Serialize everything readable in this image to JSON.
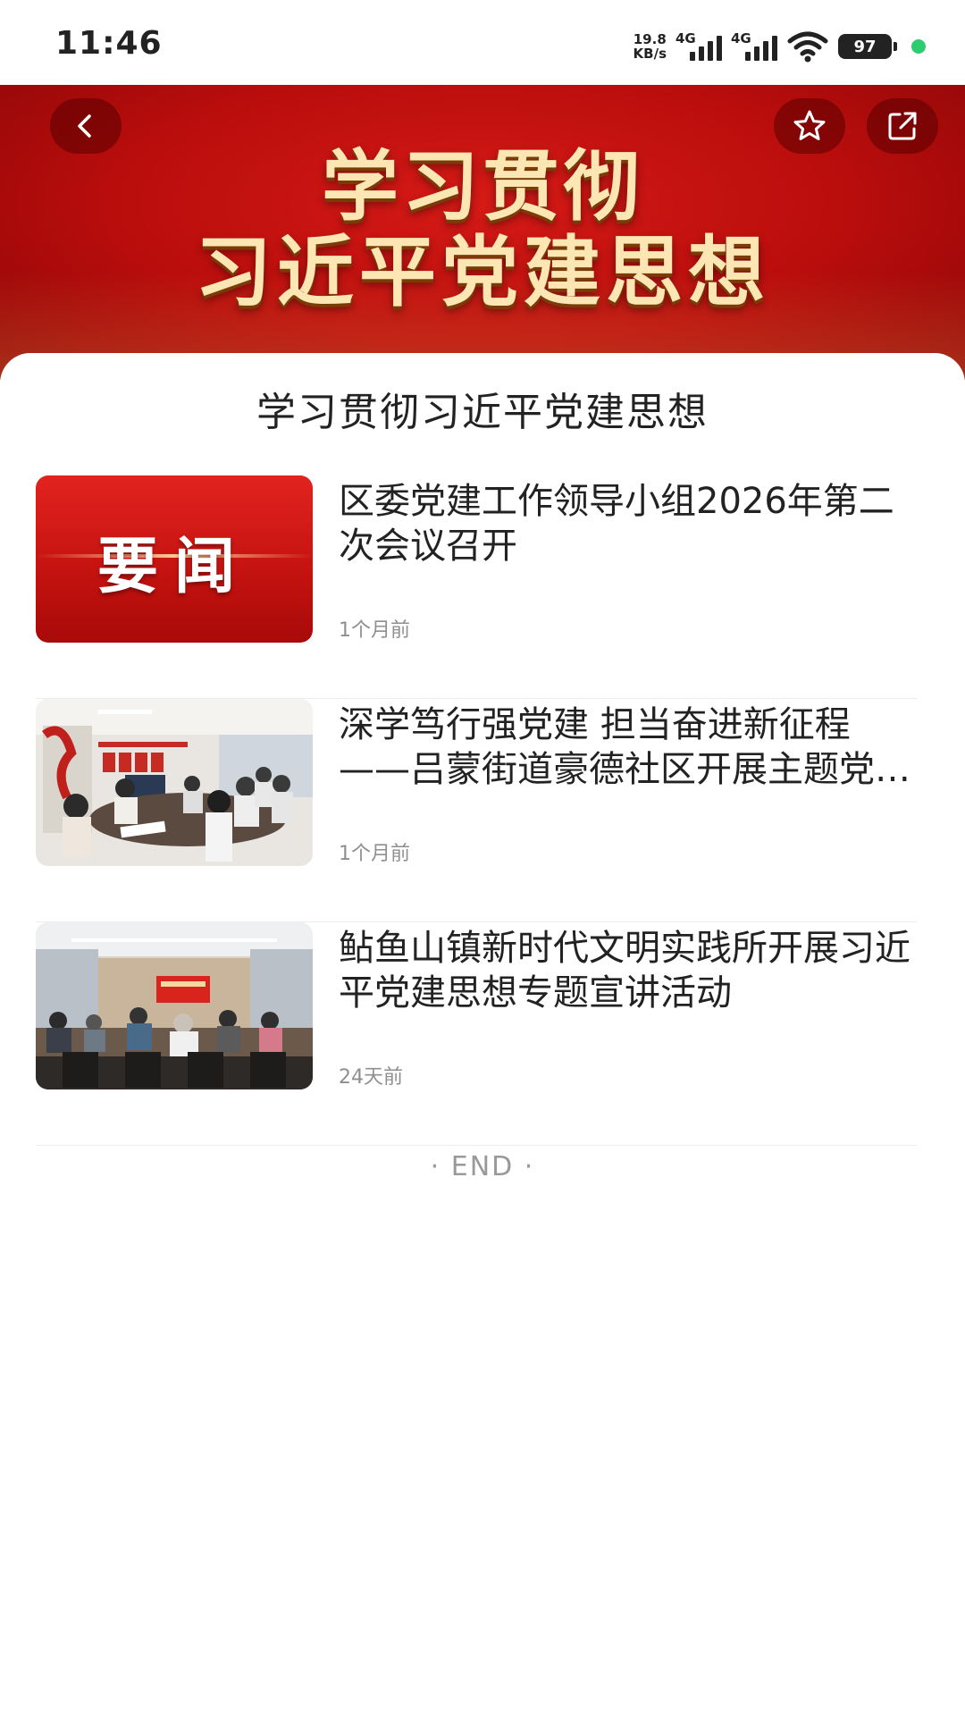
{
  "status_bar": {
    "time": "11:46",
    "net_speed_value": "19.8",
    "net_speed_unit": "KB/s",
    "signal_1_tag": "4G",
    "signal_2_tag": "4G",
    "battery": "97",
    "colors": {
      "dot": "#2ecc71"
    }
  },
  "banner": {
    "title_line1": "学习贯彻",
    "title_line2": "习近平党建思想",
    "buttons": {
      "back_icon": "back-icon",
      "favorite_icon": "star-icon",
      "share_icon": "share-icon"
    },
    "colors": {
      "background": "#c8120f",
      "title": "#fbe6b4"
    }
  },
  "list": {
    "title": "学习贯彻习近平党建思想",
    "items": [
      {
        "title": "区委党建工作领导小组2026年第二次会议召开",
        "time": "1个月前",
        "thumbnail_text": "要闻"
      },
      {
        "title": "深学笃行强党建 担当奋进新征程——吕蒙街道豪德社区开展主题党日活动",
        "time": "1个月前"
      },
      {
        "title": "鲇鱼山镇新时代文明实践所开展习近平党建思想专题宣讲活动",
        "time": "24天前"
      }
    ],
    "end_text": "· END ·"
  }
}
